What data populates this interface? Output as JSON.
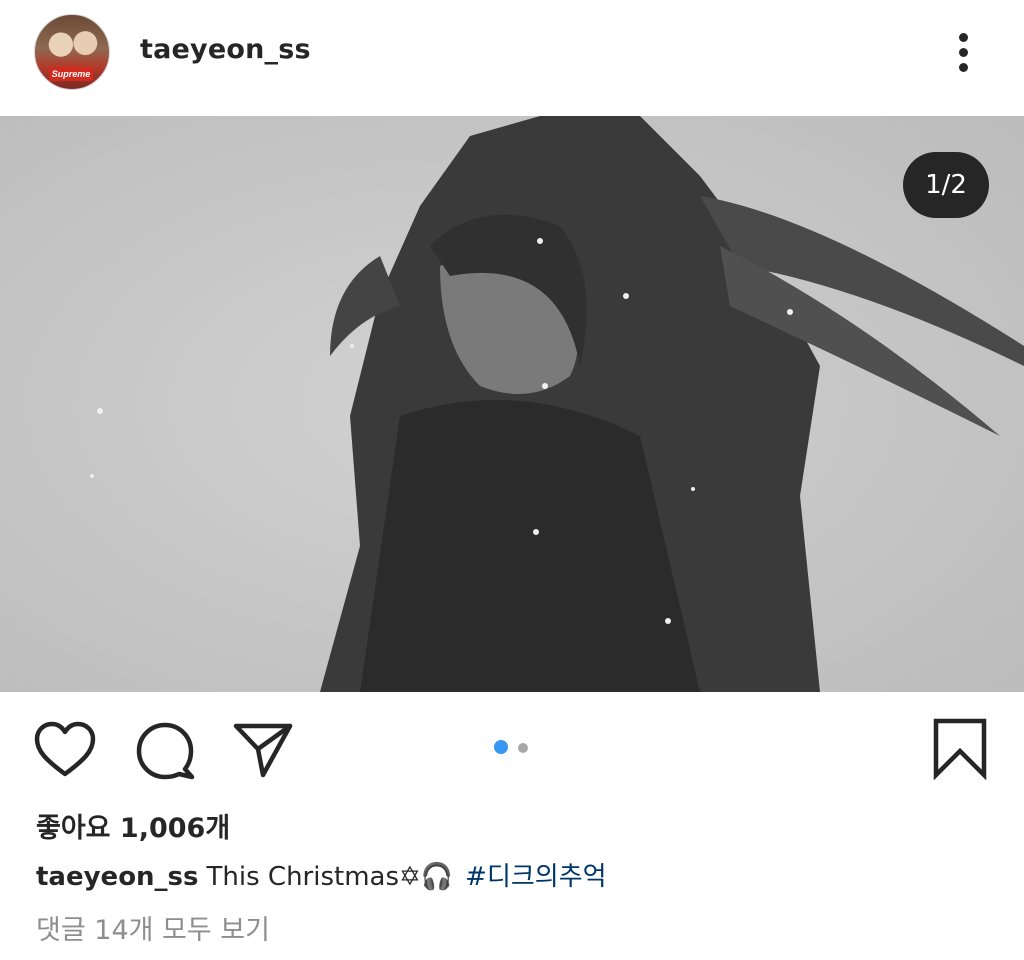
{
  "post": {
    "username": "taeyeon_ss",
    "avatar_label": "Supreme",
    "media_counter": "1/2",
    "likes_text": "좋아요 1,006개",
    "caption": {
      "username": "taeyeon_ss",
      "text": "This Christmas✡🎧",
      "hashtag": "#디크의추억"
    },
    "view_comments": "댓글 14개 모두 보기"
  },
  "icons": [
    "more-icon",
    "heart-icon",
    "comment-icon",
    "share-icon",
    "bookmark-icon"
  ],
  "carousel": {
    "total": 2,
    "active_index": 0
  },
  "colors": {
    "text": "#262626",
    "hashtag": "#003569",
    "muted": "#8e8e8e",
    "dot_active": "#3897f0",
    "dot_inactive": "#a8a8a8"
  }
}
